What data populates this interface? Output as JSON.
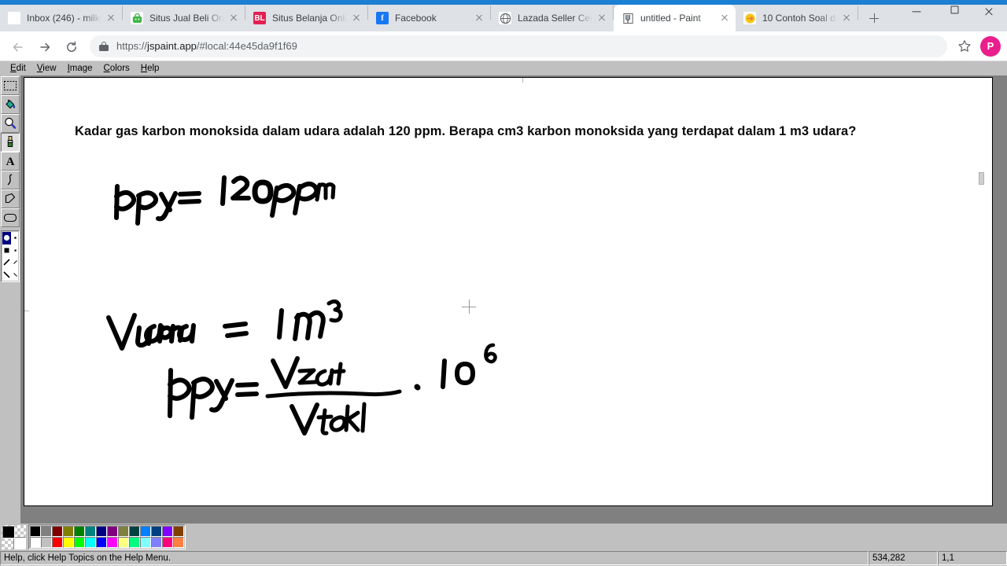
{
  "browser": {
    "tabs": [
      {
        "title": "Inbox (246) - milky",
        "favicon": "gmail-icon",
        "active": false
      },
      {
        "title": "Situs Jual Beli Onli",
        "favicon": "tokopedia-icon",
        "active": false
      },
      {
        "title": "Situs Belanja Onlin",
        "favicon": "bukalapak-icon",
        "active": false
      },
      {
        "title": "Facebook",
        "favicon": "facebook-icon",
        "active": false
      },
      {
        "title": "Lazada Seller Cent",
        "favicon": "lazada-icon",
        "active": false
      },
      {
        "title": "untitled - Paint",
        "favicon": "paint-icon",
        "active": true
      },
      {
        "title": "10 Contoh Soal da",
        "favicon": "article-icon",
        "active": false
      }
    ],
    "newtab_label": "+",
    "window_controls": {
      "minimize": "–",
      "maximize": "❐",
      "close": "✕"
    },
    "url": {
      "full": "https://jspaint.app/#local:44e45da9f1f69",
      "scheme": "https://",
      "host": "jspaint.app",
      "path": "/#local:44e45da9f1f69"
    },
    "avatar_initial": "P"
  },
  "paint": {
    "menu": [
      {
        "label": "Edit",
        "accel": "E"
      },
      {
        "label": "View",
        "accel": "V"
      },
      {
        "label": "Image",
        "accel": "I"
      },
      {
        "label": "Colors",
        "accel": "C"
      },
      {
        "label": "Help",
        "accel": "H"
      }
    ],
    "tools": [
      {
        "name": "select-rectangle-tool",
        "selected": false
      },
      {
        "name": "fill-bucket-tool",
        "selected": false
      },
      {
        "name": "magnifier-tool",
        "selected": false
      },
      {
        "name": "brush-tool",
        "selected": true
      },
      {
        "name": "text-tool",
        "selected": false
      },
      {
        "name": "curve-tool",
        "selected": false
      },
      {
        "name": "polygon-tool",
        "selected": false
      },
      {
        "name": "rounded-rectangle-tool",
        "selected": false
      }
    ],
    "foreground_color": "#000000",
    "background_color": "#ffffff",
    "palette_row1": [
      "#000000",
      "#808080",
      "#800000",
      "#808000",
      "#008000",
      "#008080",
      "#000080",
      "#800080",
      "#808040",
      "#004040",
      "#0080ff",
      "#004080",
      "#8000ff",
      "#804000"
    ],
    "palette_row2": [
      "#ffffff",
      "#c0c0c0",
      "#ff0000",
      "#ffff00",
      "#00ff00",
      "#00ffff",
      "#0000ff",
      "#ff00ff",
      "#ffff80",
      "#00ff80",
      "#80ffff",
      "#8080ff",
      "#ff0080",
      "#ff8040"
    ],
    "status": {
      "hint": "Help, click Help Topics on the Help Menu.",
      "coordinates": "534,282",
      "selection_size": "1,1"
    },
    "canvas": {
      "question": "Kadar gas karbon monoksida dalam udara adalah 120 ppm. Berapa cm3 karbon monoksida yang terdapat dalam 1 m3 udara?",
      "handwriting": [
        {
          "id": "line1",
          "text": "bpy = 120 ppm"
        },
        {
          "id": "line2",
          "text": "V udara = 1 m3"
        },
        {
          "id": "line3",
          "text": "bpy = V zat / V total . 10^6"
        }
      ]
    }
  }
}
